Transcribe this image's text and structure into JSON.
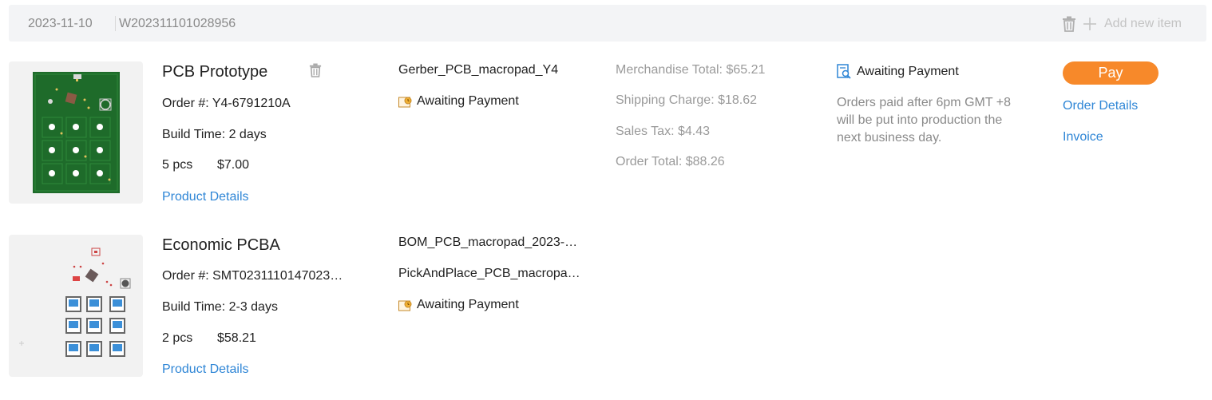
{
  "header": {
    "date": "2023-11-10",
    "order_id": "W202311101028956",
    "delete_icon": "trash-icon",
    "add_label": "Add new item"
  },
  "items": [
    {
      "name": "PCB Prototype",
      "order_number": "Order #: Y4-6791210A",
      "build_time": "Build Time: 2 days",
      "qty": "5 pcs",
      "price": "$7.00",
      "details_link": "Product Details",
      "files": [
        "Gerber_PCB_macropad_Y4"
      ],
      "file_status": "Awaiting Payment"
    },
    {
      "name": "Economic PCBA",
      "order_number": "Order #: SMT0231110147023…",
      "build_time": "Build Time: 2-3 days",
      "qty": "2 pcs",
      "price": "$58.21",
      "details_link": "Product Details",
      "files": [
        "BOM_PCB_macropad_2023-…",
        "PickAndPlace_PCB_macropa…"
      ],
      "file_status": "Awaiting Payment"
    }
  ],
  "totals": {
    "merchandise": "Merchandise Total: $65.21",
    "shipping": "Shipping Charge: $18.62",
    "tax": "Sales Tax: $4.43",
    "order_total": "Order Total: $88.26"
  },
  "payment": {
    "status": "Awaiting Payment",
    "note": "Orders paid after 6pm GMT +8 will be put into production the next business day."
  },
  "actions": {
    "pay": "Pay",
    "order_details": "Order Details",
    "invoice": "Invoice"
  },
  "colors": {
    "accent_orange": "#f7892a",
    "link_blue": "#2f86d6",
    "pcb_green": "#1e6b2a"
  }
}
